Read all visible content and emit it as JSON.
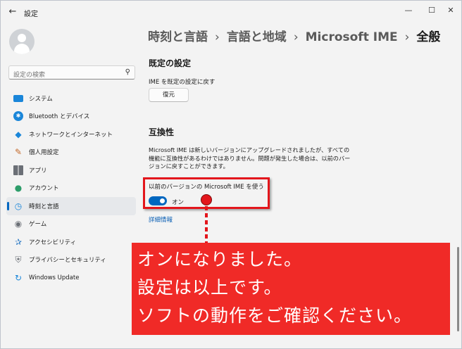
{
  "window": {
    "title": "設定",
    "controls": {
      "minimize": "—",
      "maximize": "☐",
      "close": "✕"
    }
  },
  "sidebar": {
    "search_placeholder": "設定の検索",
    "items": [
      {
        "label": "システム",
        "icon": "system-icon"
      },
      {
        "label": "Bluetooth とデバイス",
        "icon": "bluetooth-icon"
      },
      {
        "label": "ネットワークとインターネット",
        "icon": "wifi-icon"
      },
      {
        "label": "個人用設定",
        "icon": "brush-icon"
      },
      {
        "label": "アプリ",
        "icon": "apps-icon"
      },
      {
        "label": "アカウント",
        "icon": "account-icon"
      },
      {
        "label": "時刻と言語",
        "icon": "time-language-icon",
        "active": true
      },
      {
        "label": "ゲーム",
        "icon": "gamepad-icon"
      },
      {
        "label": "アクセシビリティ",
        "icon": "accessibility-icon"
      },
      {
        "label": "プライバシーとセキュリティ",
        "icon": "shield-icon"
      },
      {
        "label": "Windows Update",
        "icon": "update-icon"
      }
    ]
  },
  "breadcrumb": {
    "items": [
      "時刻と言語",
      "言語と地域",
      "Microsoft IME"
    ],
    "current": "全般",
    "separator": "›"
  },
  "default_section": {
    "title": "既定の設定",
    "reset_label": "IME を既定の設定に戻す",
    "reset_button": "復元"
  },
  "compat_section": {
    "title": "互換性",
    "description": "Microsoft IME は新しいバージョンにアップグレードされましたが、すべての機能に互換性があるわけではありません。問題が発生した場合は、以前のバージョンに戻すことができます。",
    "toggle_label": "以前のバージョンの Microsoft IME を使う",
    "toggle_state": "オン",
    "toggle_on": true,
    "detail_link": "詳細情報"
  },
  "annotation": {
    "lines": [
      "オンになりました。",
      "設定は以上です。",
      "ソフトの動作をご確認ください。"
    ],
    "color": "#f02a27"
  },
  "colors": {
    "accent": "#0067c0",
    "annotation_red": "#e3161c"
  }
}
